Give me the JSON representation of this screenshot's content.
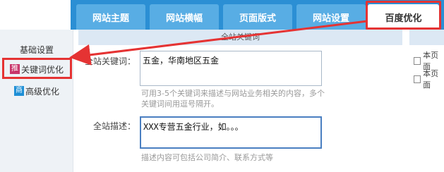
{
  "tabs": [
    {
      "label": "网站主题"
    },
    {
      "label": "网站横幅"
    },
    {
      "label": "页面版式"
    },
    {
      "label": "网站设置"
    },
    {
      "label": "百度优化"
    }
  ],
  "sidebar": {
    "items": [
      {
        "label": "基础设置",
        "badge": ""
      },
      {
        "label": "关键词优化",
        "badge": "推"
      },
      {
        "label": "高级优化",
        "badge": "商"
      }
    ]
  },
  "section": {
    "title": "全站关键词"
  },
  "form": {
    "keywords_label": "全站关键词：",
    "keywords_value": "五金，华南地区五金",
    "keywords_hint": "可用3-5个关键词来描述与网站业务相关的内容，多个关键词间用逗号隔开。",
    "description_label": "全站描述：",
    "description_value": "XXX专营五金行业，如。。。",
    "description_hint": "描述内容可包括公司简介、联系方式等"
  },
  "right_panel": {
    "checkbox1_label": "本页面",
    "checkbox2_label": "本页面"
  },
  "colors": {
    "tab_bar": "#2b8fd4",
    "tab": "#58ade4",
    "highlight": "#e53333"
  }
}
